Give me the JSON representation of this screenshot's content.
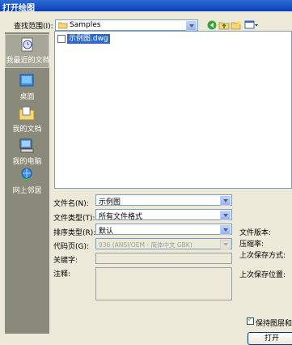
{
  "window": {
    "title": "打开绘图"
  },
  "look_in": {
    "label": "查找范围(I):",
    "value": "Samples"
  },
  "places": [
    {
      "label": "我最近的文档",
      "icon": "recent-docs-icon"
    },
    {
      "label": "桌面",
      "icon": "desktop-icon"
    },
    {
      "label": "我的文档",
      "icon": "my-documents-icon"
    },
    {
      "label": "我的电脑",
      "icon": "my-computer-icon"
    },
    {
      "label": "网上邻居",
      "icon": "network-icon"
    }
  ],
  "files": [
    {
      "name": "示例图.dwg",
      "selected": true
    }
  ],
  "form": {
    "filename": {
      "label": "文件名(N):",
      "value": "示例图"
    },
    "filetype": {
      "label": "文件类型(T):",
      "value": "所有文件格式"
    },
    "sort": {
      "label": "排序类型(R):",
      "value": "默认"
    },
    "codepage": {
      "label": "代码页(G):",
      "value": "936 (ANSI/OEM - 简体中文 GBK)"
    },
    "keywords": {
      "label": "关键字:"
    },
    "comments": {
      "label": "注释:"
    }
  },
  "info": {
    "version": "文件版本:",
    "compression": "压缩率:",
    "last_save_method": "上次保存方式:",
    "last_save_location": "上次保存位置:"
  },
  "keep_layers": {
    "label": "保持图层和顶",
    "checked": true
  },
  "open_button": {
    "label": "打开"
  }
}
